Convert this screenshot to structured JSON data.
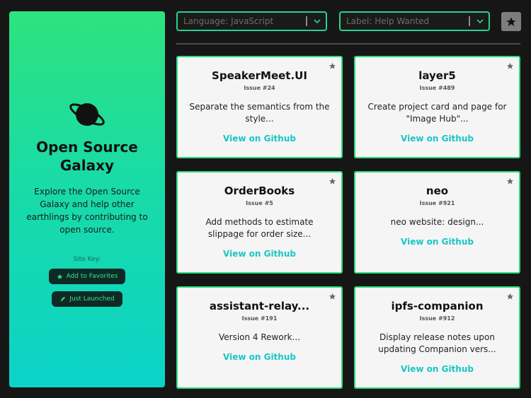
{
  "sidebar": {
    "title": "Open Source Galaxy",
    "description": "Explore the Open Source Galaxy and help other earthlings by contributing to open source.",
    "site_key_label": "Site Key:",
    "favorites_key": "Add to Favorites",
    "launched_key": "Just Launched"
  },
  "filters": {
    "language": "Language: JavaScript",
    "label": "Label: Help Wanted"
  },
  "cards": [
    {
      "name": "SpeakerMeet.UI",
      "issue": "Issue #24",
      "text": "Separate the semantics from the style...",
      "link": "View on Github"
    },
    {
      "name": "layer5",
      "issue": "Issue #489",
      "text": "Create project card and page for \"Image Hub\"...",
      "link": "View on Github"
    },
    {
      "name": "OrderBooks",
      "issue": "Issue #5",
      "text": "Add methods to estimate slippage for order size...",
      "link": "View on Github"
    },
    {
      "name": "neo",
      "issue": "Issue #921",
      "text": "neo website: design...",
      "link": "View on Github"
    },
    {
      "name": "assistant-relay...",
      "issue": "Issue #191",
      "text": "Version 4 Rework...",
      "link": "View on Github"
    },
    {
      "name": "ipfs-companion",
      "issue": "Issue #912",
      "text": "Display release notes upon updating Companion vers...",
      "link": "View on Github"
    }
  ],
  "colors": {
    "accent": "#2bdc7d",
    "link": "#19c6c6",
    "background": "#161616"
  }
}
